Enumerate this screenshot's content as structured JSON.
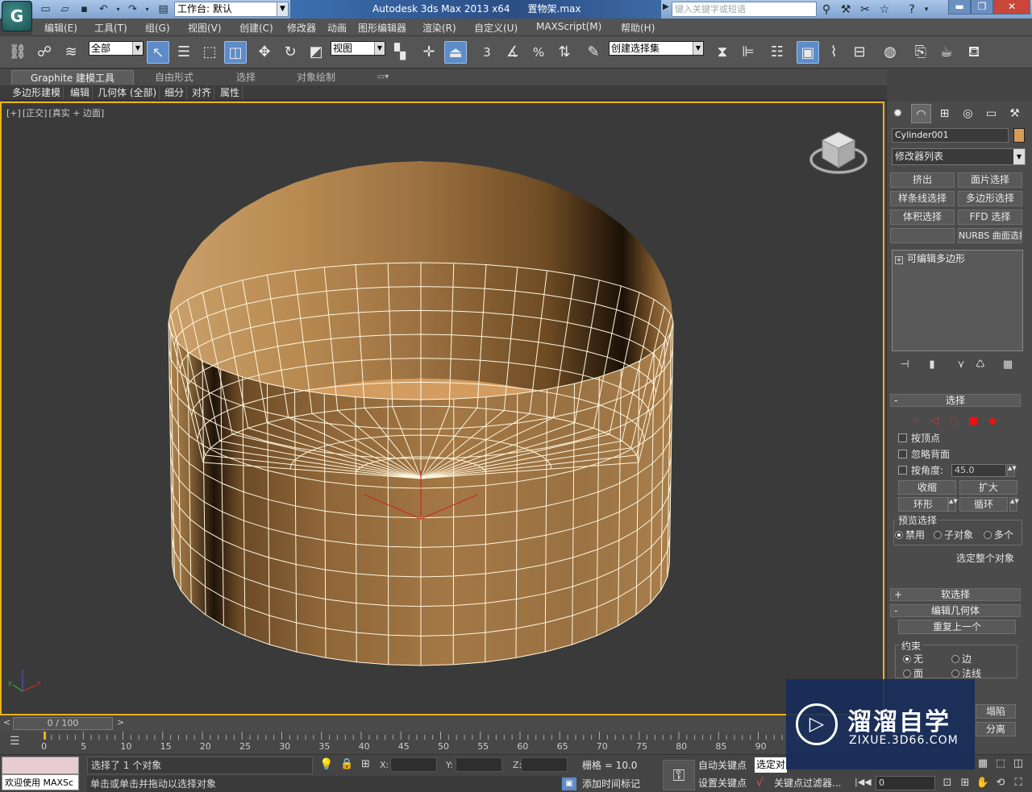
{
  "titlebar": {
    "app_logo": "G",
    "workspace_label": "工作台: 默认",
    "app_name": "Autodesk 3ds Max  2013 x64",
    "file_name": "置物架.max",
    "search_placeholder": "键入关键字或短语"
  },
  "menubar": {
    "items": [
      "编辑(E)",
      "工具(T)",
      "组(G)",
      "视图(V)",
      "创建(C)",
      "修改器",
      "动画",
      "图形编辑器",
      "渲染(R)",
      "自定义(U)",
      "MAXScript(M)",
      "帮助(H)"
    ]
  },
  "main_toolbar": {
    "selection_filter": "全部",
    "reference_coord": "视图",
    "named_selection_set": "创建选择集",
    "snap_label": "3",
    "percent_label": "%"
  },
  "ribbon": {
    "tabs": [
      "Graphite 建模工具",
      "自由形式",
      "选择",
      "对象绘制"
    ],
    "subtabs": [
      "多边形建模",
      "编辑",
      "几何体 (全部)",
      "细分",
      "对齐",
      "属性"
    ]
  },
  "viewport": {
    "label_plus": "[+]",
    "label_view": "[正交]",
    "label_shading": "[真实 + 边面]",
    "axis_x": "x",
    "axis_y": "y",
    "axis_z": "z"
  },
  "command_panel": {
    "object_name": "Cylinder001",
    "object_color": "#d99a5a",
    "modifier_list": "修改器列表",
    "modifier_buttons": [
      "挤出",
      "面片选择",
      "样条线选择",
      "多边形选择",
      "体积选择",
      "FFD 选择",
      "",
      "NURBS 曲面选择"
    ],
    "stack_item": "可编辑多边形",
    "selection_rollout": {
      "title": "选择",
      "by_vertex": "按顶点",
      "ignore_backfacing": "忽略背面",
      "by_angle": "按角度:",
      "angle_value": "45.0",
      "shrink": "收缩",
      "grow": "扩大",
      "ring": "环形",
      "loop": "循环",
      "preview_selection": "预览选择",
      "preview_off": "禁用",
      "preview_subobject": "子对象",
      "preview_multi": "多个",
      "select_whole": "选定整个对象"
    },
    "soft_selection_title": "软选择",
    "edit_geometry_title": "编辑几何体",
    "repeat_last": "重复上一个",
    "constraints": {
      "title": "约束",
      "none": "无",
      "edge": "边",
      "face": "面",
      "normal": "法线"
    },
    "collapse_partial": "塌陷",
    "detach_partial": "分离"
  },
  "timeline": {
    "frame_display": "0 / 100",
    "ticks": [
      "0",
      "5",
      "10",
      "15",
      "20",
      "25",
      "30",
      "35",
      "40",
      "45",
      "50",
      "55",
      "60",
      "65",
      "70",
      "75",
      "80",
      "85",
      "90"
    ]
  },
  "status_bar": {
    "maxscript_welcome": "欢迎使用 MAXSc",
    "selected_count": "选择了 1 个对象",
    "prompt": "单击或单击并拖动以选择对象",
    "x_label": "X:",
    "y_label": "Y:",
    "z_label": "Z:",
    "grid": "栅格 = 10.0",
    "add_time_tag": "添加时间标记",
    "auto_key": "自动关键点",
    "set_key": "设置关键点",
    "selected_dropdown": "选定对",
    "key_filters": "关键点过滤器...",
    "frame_value": "0"
  },
  "watermark": {
    "title": "溜溜自学",
    "url": "ZIXUE.3D66.COM"
  },
  "colors": {
    "viewport_border": "#e9b31b",
    "cylinder_light": "#d8a36a",
    "cylinder_dark": "#6d4a23",
    "wire": "#fff7df"
  }
}
